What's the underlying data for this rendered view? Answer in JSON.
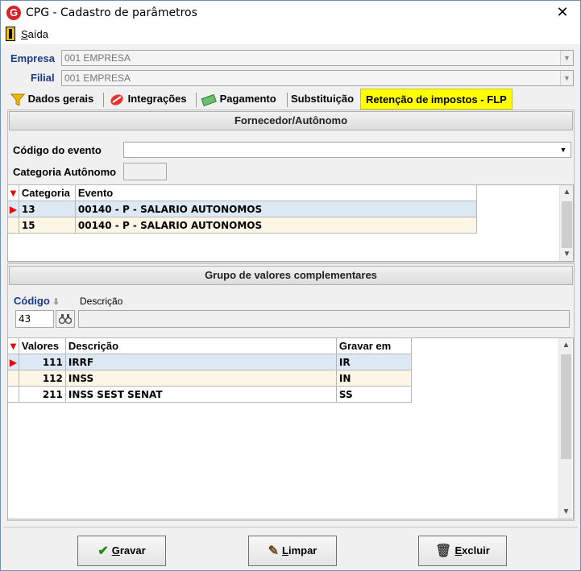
{
  "window": {
    "title": "CPG - Cadastro de parâmetros",
    "close_glyph": "✕",
    "logo_letter": "G"
  },
  "menu": {
    "exit_label": "Saída",
    "exit_accel": "S",
    "exit_rest": "aída"
  },
  "empresa": {
    "label": "Empresa",
    "value": "001 EMPRESA"
  },
  "filial": {
    "label": "Filial",
    "value": "001 EMPRESA"
  },
  "tabs": [
    {
      "label": "Dados gerais",
      "icon": "funnel-icon",
      "active": false
    },
    {
      "label": "Integrações",
      "icon": "integration-icon",
      "active": false
    },
    {
      "label": "Pagamento",
      "icon": "money-icon",
      "active": false
    },
    {
      "label": "Substituição",
      "icon": "",
      "active": false
    },
    {
      "label": "Retenção de impostos - FLP",
      "icon": "",
      "active": true
    }
  ],
  "fornecedor": {
    "header": "Fornecedor/Autônomo",
    "codigo_evento_label": "Código do evento",
    "codigo_evento_value": "",
    "categoria_label": "Categoria Autônomo",
    "categoria_value": "",
    "grid": {
      "columns": [
        "Categoria",
        "Evento"
      ],
      "rows": [
        {
          "categoria": "13",
          "evento": "00140 - P - SALARIO AUTONOMOS"
        },
        {
          "categoria": "15",
          "evento": "00140 - P - SALARIO AUTONOMOS"
        }
      ]
    }
  },
  "grupo": {
    "header": "Grupo de valores complementares",
    "codigo_label": "Código",
    "descricao_label": "Descrição",
    "codigo_value": "43",
    "descricao_value": "",
    "grid": {
      "columns": [
        "Valores",
        "Descrição",
        "Gravar em"
      ],
      "rows": [
        {
          "valor": "111",
          "descricao": "IRRF",
          "gravar": "IR"
        },
        {
          "valor": "112",
          "descricao": "INSS",
          "gravar": "IN"
        },
        {
          "valor": "211",
          "descricao": "INSS SEST SENAT",
          "gravar": "SS"
        }
      ]
    }
  },
  "buttons": {
    "gravar": {
      "accel": "G",
      "rest": "ravar",
      "icon": "checkmark-icon"
    },
    "limpar": {
      "accel": "L",
      "rest": "impar",
      "icon": "eraser-icon"
    },
    "excluir": {
      "accel": "E",
      "rest": "xcluir",
      "icon": "trash-icon"
    }
  },
  "colors": {
    "accent_yellow": "#ffff00",
    "label_blue": "#1a3a8a",
    "selected_row": "#dde8f5",
    "alt_row": "#fdf6e7"
  }
}
